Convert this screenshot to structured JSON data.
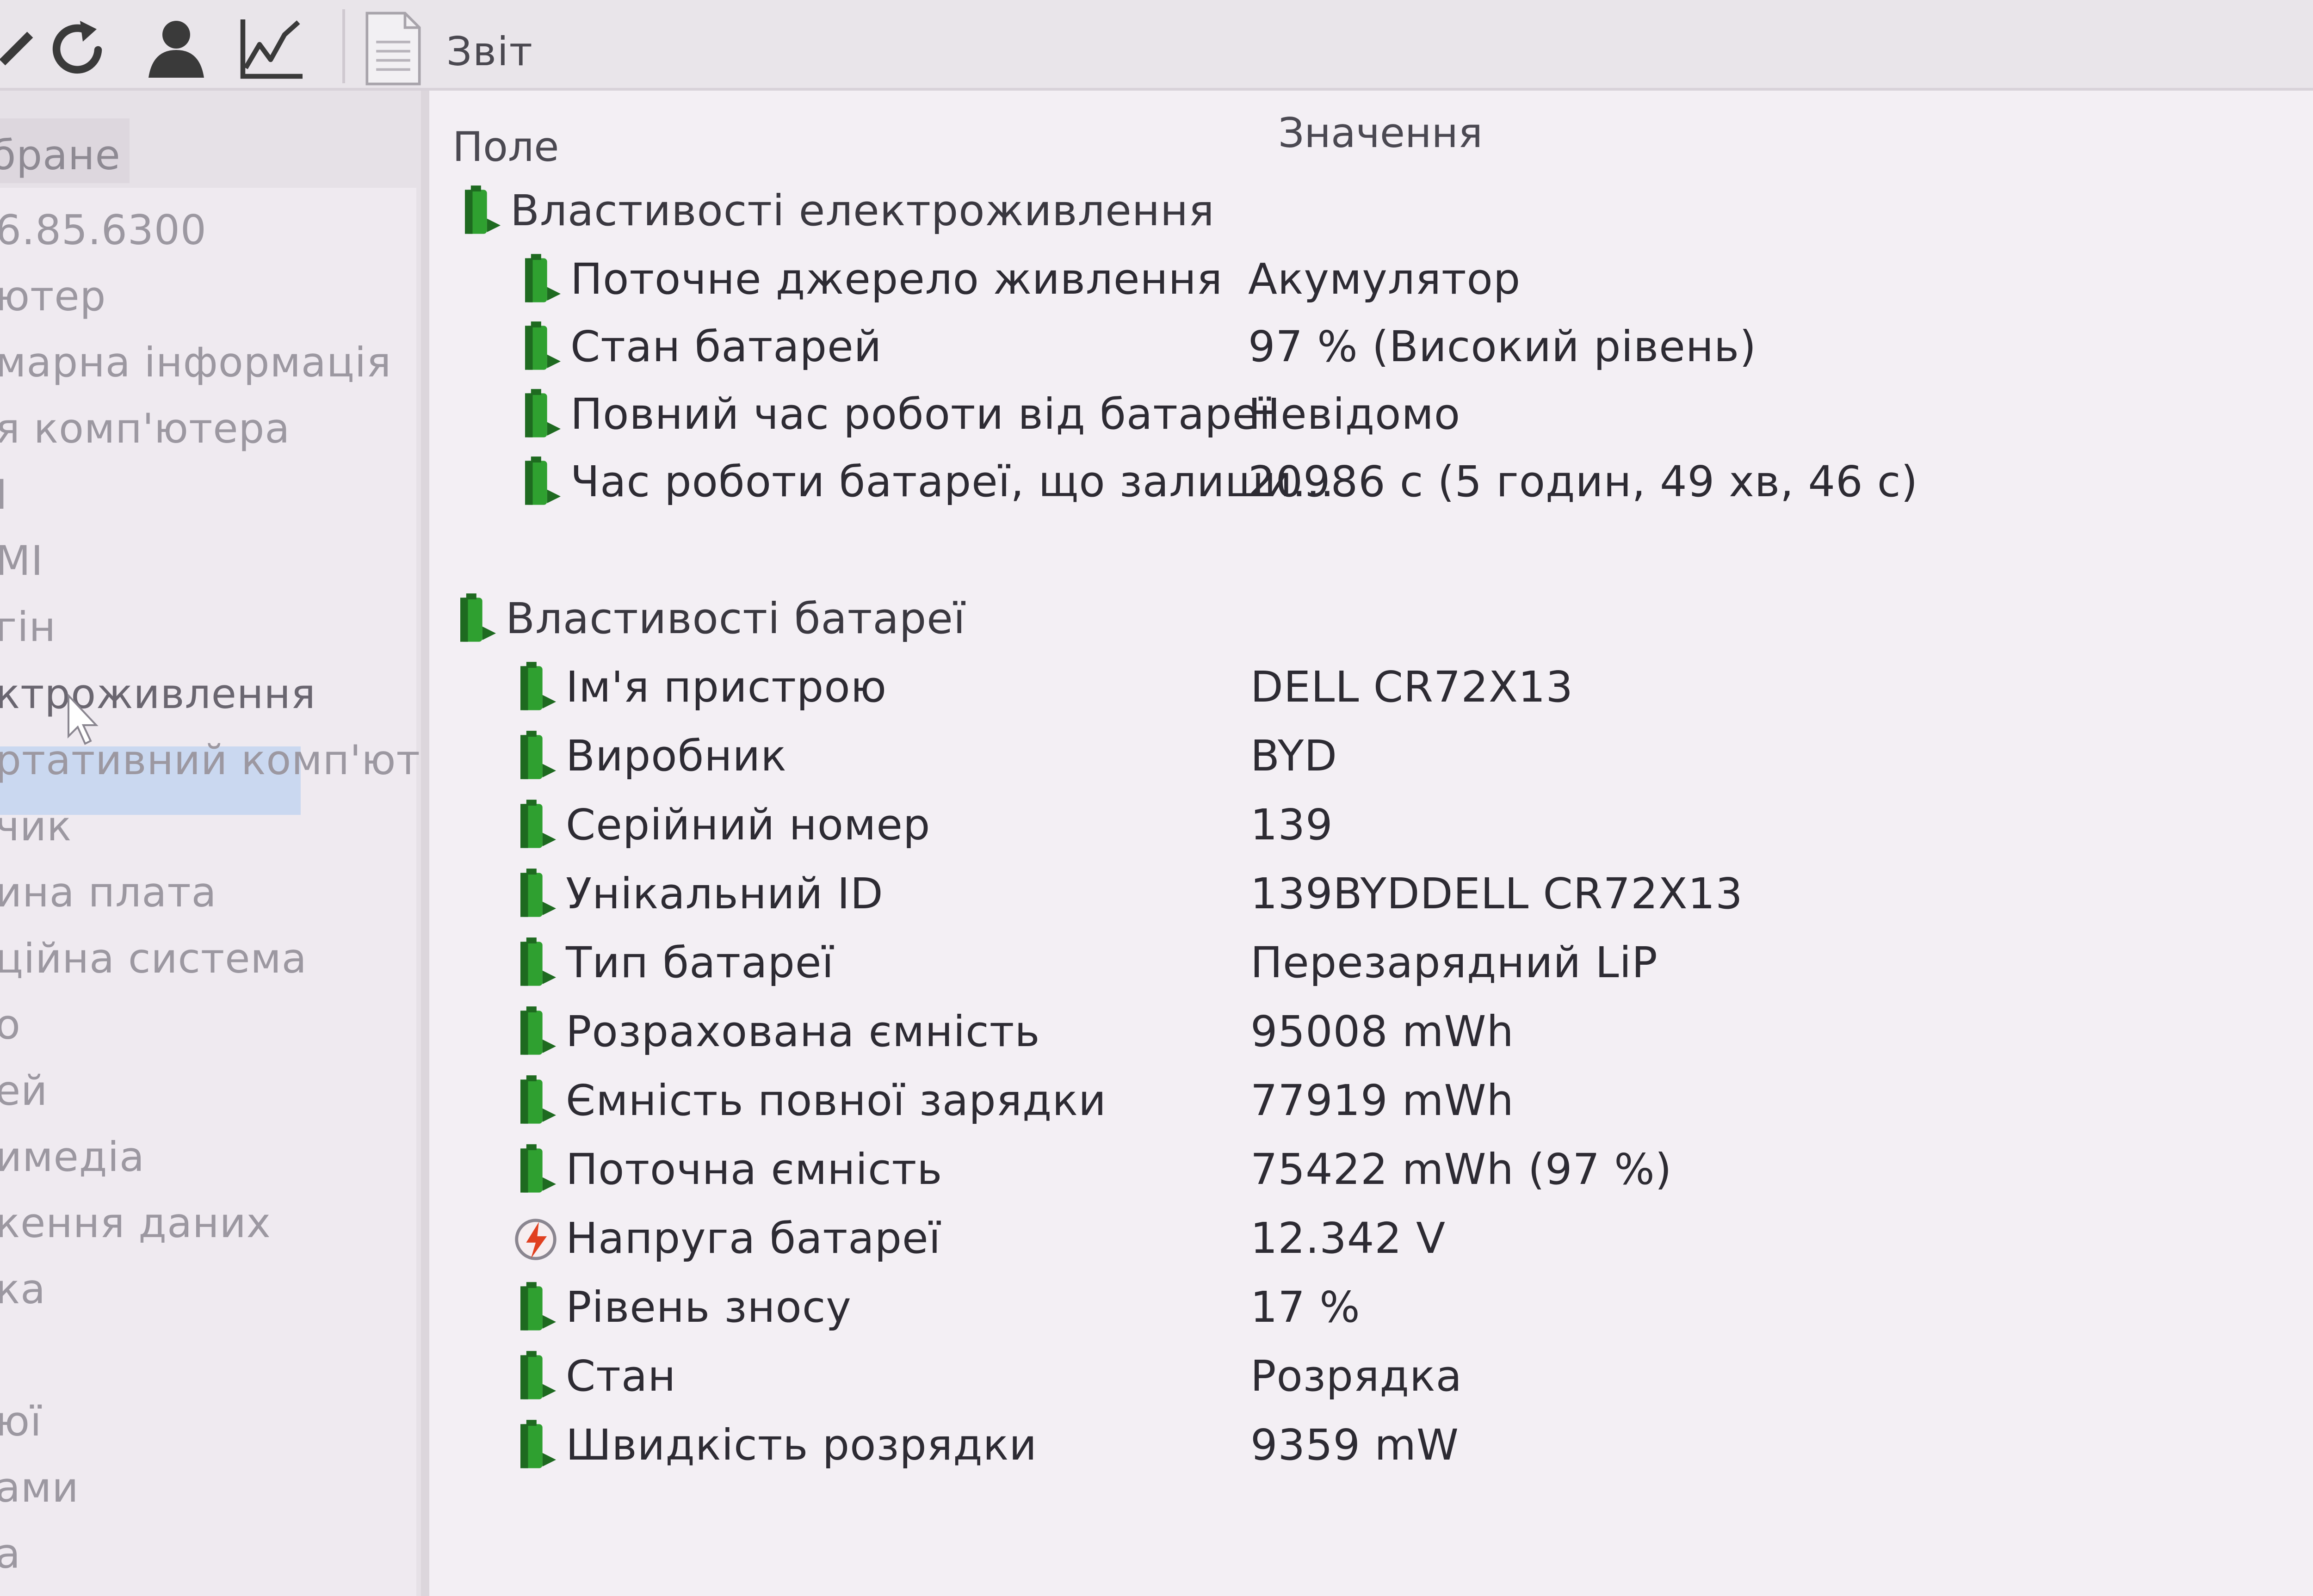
{
  "toolbar": {
    "icons": [
      "back-arrow-icon",
      "refresh-icon",
      "user-icon",
      "chart-icon",
      "report-icon"
    ],
    "report_label": "Звіт"
  },
  "sidebar": {
    "header": "бране",
    "items": [
      {
        "label": "6.85.6300"
      },
      {
        "label": "ютер"
      },
      {
        "label": "марна інформація"
      },
      {
        "label": "я комп'ютера"
      },
      {
        "label": "I"
      },
      {
        "label": "MI"
      },
      {
        "label": "гін"
      },
      {
        "label": "ктроживлення",
        "selected": true
      },
      {
        "label": "ртативний комп'юте"
      },
      {
        "label": "чик"
      },
      {
        "label": "ина плата"
      },
      {
        "label": "ційна система"
      },
      {
        "label": "о"
      },
      {
        "label": "ей"
      },
      {
        "label": "имедіа"
      },
      {
        "label": "кення даних"
      },
      {
        "label": "ка"
      },
      {
        "label": ""
      },
      {
        "label": "юї"
      },
      {
        "label": "ами"
      },
      {
        "label": "а"
      }
    ]
  },
  "table": {
    "columns": {
      "field": "Поле",
      "value": "Значення"
    },
    "sections": [
      {
        "title": "Властивості електроживлення",
        "icon": "battery-icon",
        "rows": [
          {
            "field": "Поточне джерело живлення",
            "value": "Акумулятор",
            "icon": "battery-icon"
          },
          {
            "field": "Стан батарей",
            "value": "97 % (Високий рівень)",
            "icon": "battery-icon"
          },
          {
            "field": "Повний час роботи від батареї",
            "value": "Невідомо",
            "icon": "battery-icon"
          },
          {
            "field": "Час роботи батареї, що залиши...",
            "value": "20986 с (5 годин, 49 хв, 46 с)",
            "icon": "battery-icon"
          }
        ]
      },
      {
        "title": "Властивості батареї",
        "icon": "battery-icon",
        "rows": [
          {
            "field": "Ім'я пристрою",
            "value": "DELL CR72X13",
            "icon": "battery-icon"
          },
          {
            "field": "Виробник",
            "value": "BYD",
            "icon": "battery-icon"
          },
          {
            "field": "Серійний номер",
            "value": "139",
            "icon": "battery-icon"
          },
          {
            "field": "Унікальний ID",
            "value": "139BYDDELL CR72X13",
            "icon": "battery-icon"
          },
          {
            "field": "Тип батареї",
            "value": "Перезарядний LiP",
            "icon": "battery-icon"
          },
          {
            "field": "Розрахована ємність",
            "value": "95008 mWh",
            "icon": "battery-icon"
          },
          {
            "field": "Ємність повної зарядки",
            "value": "77919 mWh",
            "icon": "battery-icon"
          },
          {
            "field": "Поточна ємність",
            "value": "75422 mWh  (97 %)",
            "icon": "battery-icon"
          },
          {
            "field": "Напруга батареї",
            "value": "12.342 V",
            "icon": "voltage-icon"
          },
          {
            "field": "Рівень зносу",
            "value": "17 %",
            "icon": "battery-icon"
          },
          {
            "field": "Стан",
            "value": "Розрядка",
            "icon": "battery-icon"
          },
          {
            "field": "Швидкість розрядки",
            "value": "9359 mW",
            "icon": "battery-icon"
          }
        ]
      }
    ]
  },
  "colors": {
    "battery_green": "#2fa030",
    "battery_dark": "#1e6a20",
    "selection": "#cad8f0",
    "voltage_red": "#e04020"
  }
}
